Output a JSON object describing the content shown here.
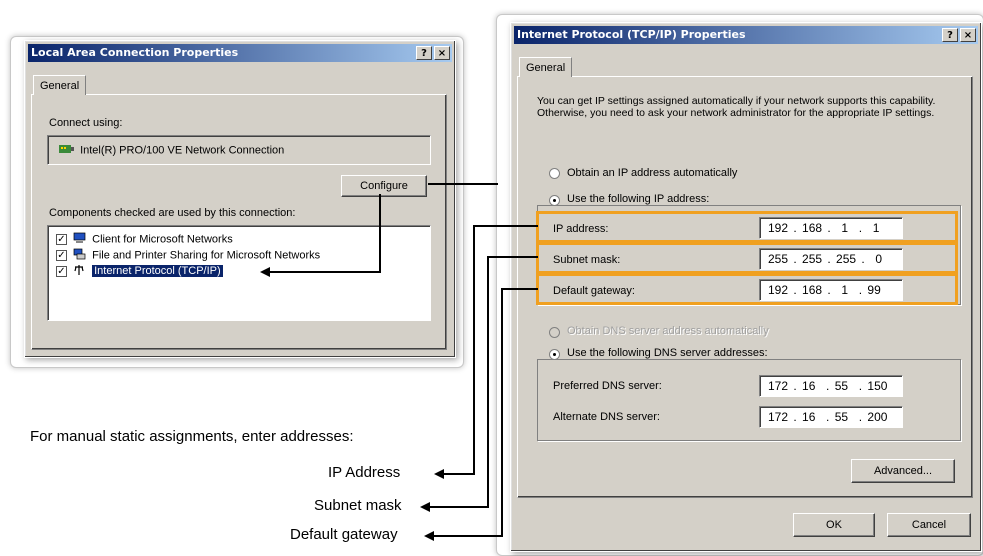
{
  "lac_window": {
    "title": "Local Area Connection Properties",
    "help_btn": "?",
    "close_btn": "×",
    "tab_general": "General",
    "connect_using_label": "Connect using:",
    "adapter_name": "Intel(R) PRO/100 VE Network Connection",
    "configure_button": "Configure",
    "components_label": "Components checked are used by this connection:",
    "components": [
      {
        "label": "Client for Microsoft Networks",
        "checked": true,
        "icon": "network-client-icon"
      },
      {
        "label": "File and Printer Sharing for Microsoft Networks",
        "checked": true,
        "icon": "printer-sharing-icon"
      },
      {
        "label": "Internet Protocol (TCP/IP)",
        "checked": true,
        "icon": "protocol-icon",
        "selected": true
      }
    ],
    "check_mark": "✓"
  },
  "tcpip_window": {
    "title": "Internet Protocol (TCP/IP) Properties",
    "help_btn": "?",
    "close_btn": "×",
    "tab_general": "General",
    "intro_text": "You can get IP settings assigned automatically if your network supports this capability. Otherwise, you need to ask your network administrator for the appropriate IP settings.",
    "radio_auto_ip": "Obtain an IP address automatically",
    "radio_manual_ip": "Use the following IP address:",
    "ip_address_label": "IP address:",
    "ip_address_value": "192 . 168 .  1  .  1",
    "subnet_label": "Subnet mask:",
    "subnet_value": "255 . 255 . 255 .  0",
    "gateway_label": "Default gateway:",
    "gateway_value": "192 . 168 .  1  . 99",
    "radio_auto_dns": "Obtain DNS server address automatically",
    "radio_manual_dns": "Use the following DNS server addresses:",
    "preferred_dns_label": "Preferred DNS server:",
    "preferred_dns_value": "172 . 16  . 55  . 150",
    "alternate_dns_label": "Alternate DNS server:",
    "alternate_dns_value": "172 . 16  . 55  . 200",
    "advanced_button": "Advanced...",
    "ok_button": "OK",
    "cancel_button": "Cancel"
  },
  "annotation": {
    "caption": "For manual static assignments, enter addresses:",
    "ip_address": "IP Address",
    "subnet_mask": "Subnet mask",
    "default_gateway": "Default gateway",
    "highlight_color": "#f0a020"
  }
}
